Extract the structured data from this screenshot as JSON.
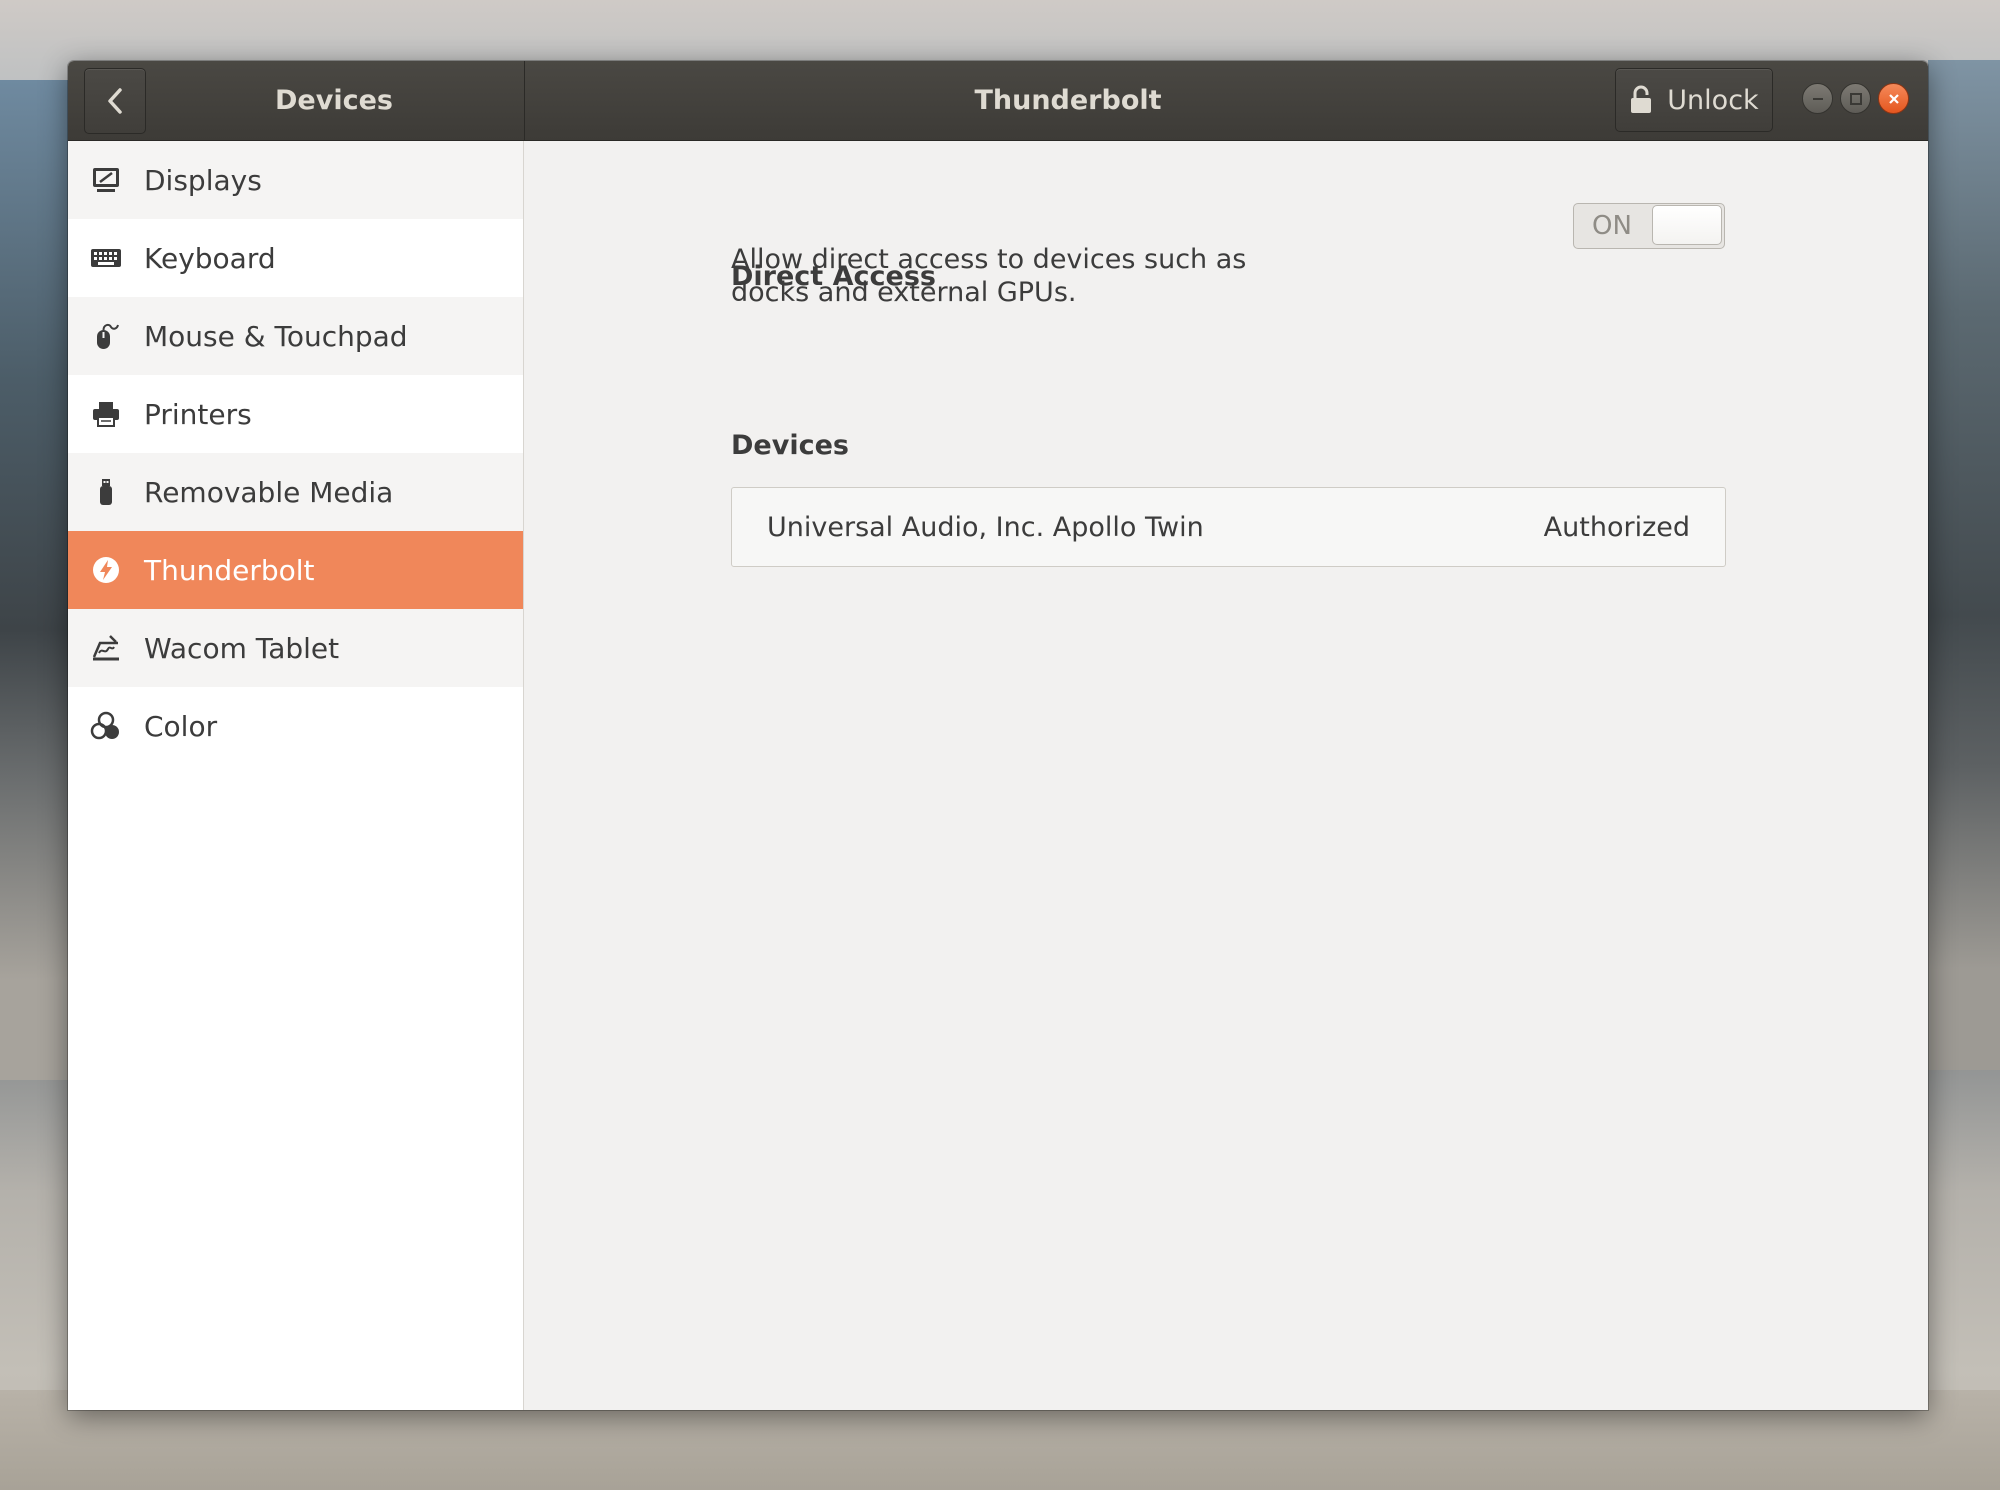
{
  "titlebar": {
    "panel_title": "Devices",
    "page_title": "Thunderbolt",
    "unlock_label": "Unlock"
  },
  "sidebar": {
    "items": [
      {
        "label": "Displays",
        "icon": "display-icon"
      },
      {
        "label": "Keyboard",
        "icon": "keyboard-icon"
      },
      {
        "label": "Mouse & Touchpad",
        "icon": "mouse-icon"
      },
      {
        "label": "Printers",
        "icon": "printer-icon"
      },
      {
        "label": "Removable Media",
        "icon": "usb-drive-icon"
      },
      {
        "label": "Thunderbolt",
        "icon": "thunderbolt-icon",
        "selected": true
      },
      {
        "label": "Wacom Tablet",
        "icon": "tablet-icon"
      },
      {
        "label": "Color",
        "icon": "color-icon"
      }
    ]
  },
  "main": {
    "direct_access": {
      "title": "Direct Access",
      "description": "Allow direct access to devices such as docks and external GPUs.",
      "toggle_label": "ON",
      "enabled": true
    },
    "devices": {
      "heading": "Devices",
      "items": [
        {
          "name": "Universal Audio, Inc. Apollo Twin",
          "status": "Authorized"
        }
      ]
    }
  },
  "colors": {
    "accent": "#f0875a",
    "titlebar": "#413f3b",
    "close_button": "#e95420"
  }
}
